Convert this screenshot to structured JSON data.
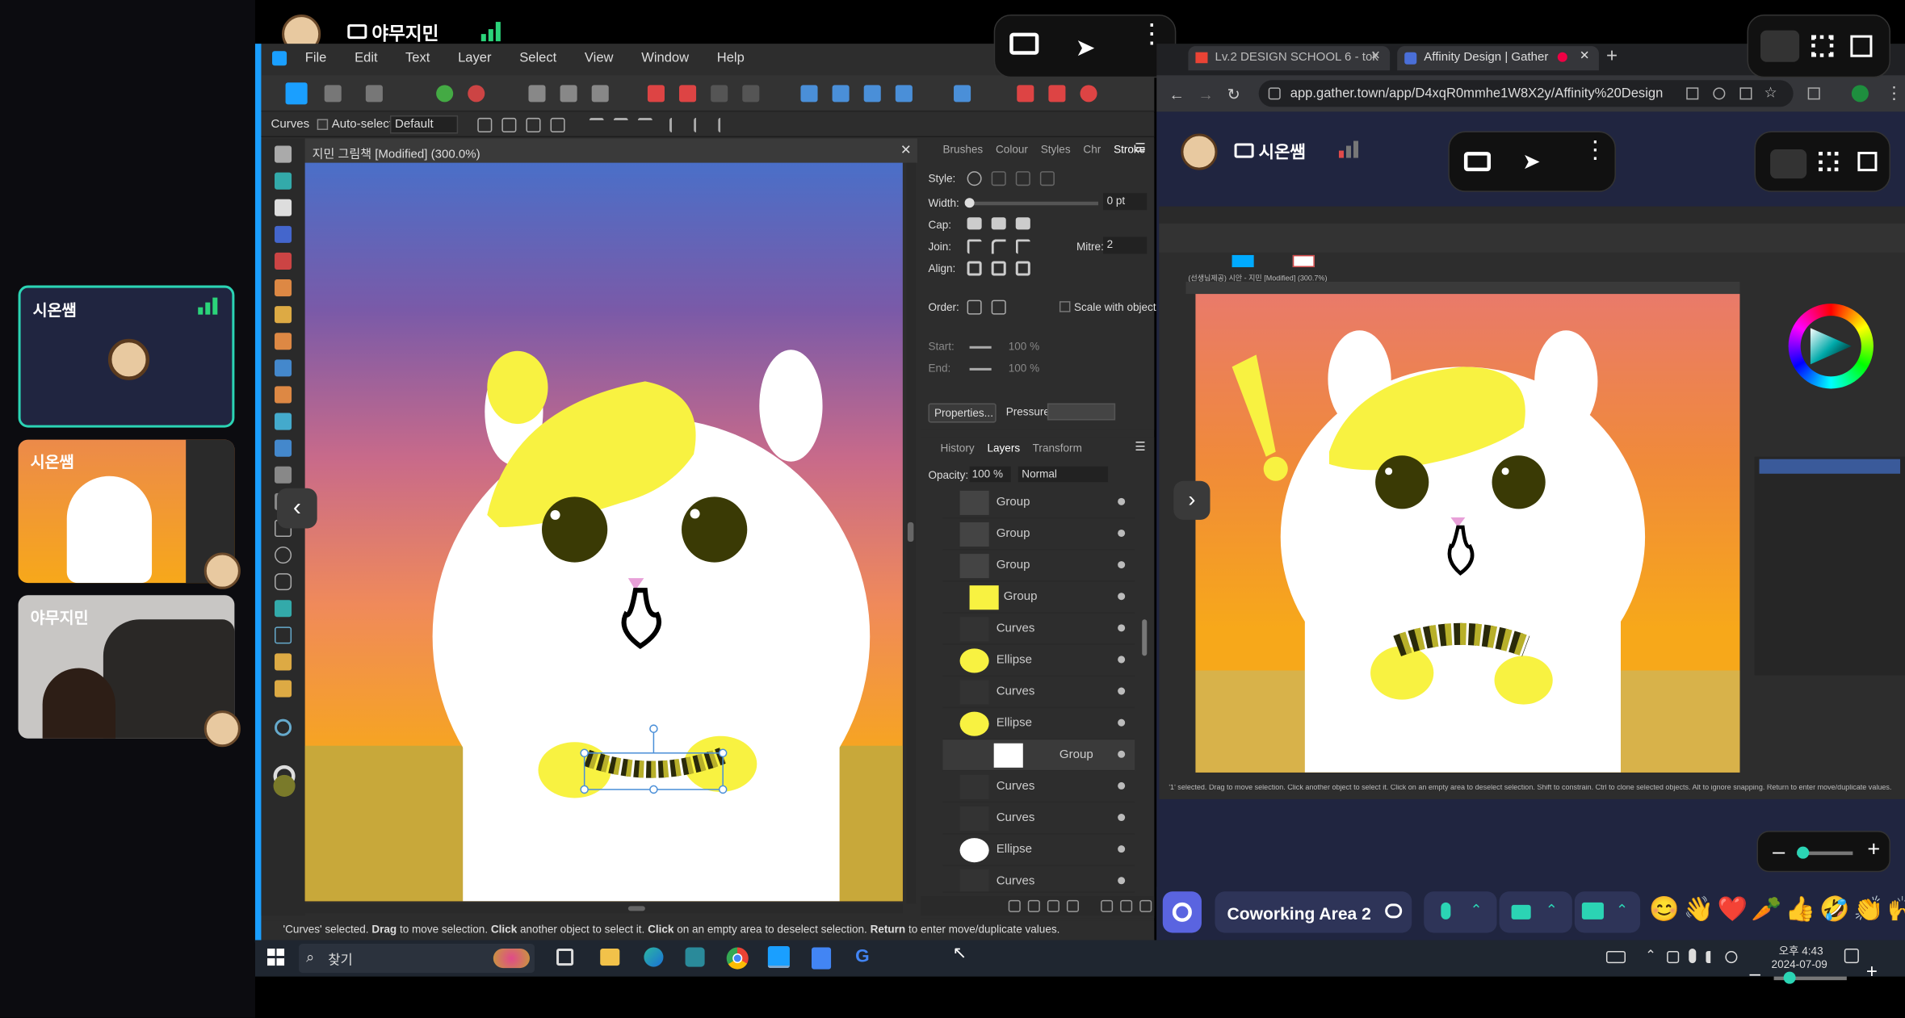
{
  "left_panel": {
    "top_user": "야무지민",
    "tiles": [
      {
        "name": "시온쌤"
      },
      {
        "name": "시온쌤"
      },
      {
        "name": "야무지민"
      }
    ]
  },
  "affinity": {
    "menu": [
      "File",
      "Edit",
      "Text",
      "Layer",
      "Select",
      "View",
      "Window",
      "Help"
    ],
    "context_tool": "Curves",
    "auto_select_label": "Auto-select:",
    "auto_select_value": "Default",
    "doc_title": "지민 그림책 [Modified] (300.0%)",
    "stroke_tabs": [
      "Brushes",
      "Colour",
      "Styles",
      "Chr",
      "Stroke"
    ],
    "stroke": {
      "style_label": "Style:",
      "width_label": "Width:",
      "width_value": "0 pt",
      "cap_label": "Cap:",
      "join_label": "Join:",
      "mitre_label": "Mitre:",
      "mitre_value": "2",
      "align_label": "Align:",
      "order_label": "Order:",
      "scale_label": "Scale with object",
      "start_label": "Start:",
      "end_label": "End:",
      "start_pct": "100 %",
      "start_pct2": "100 %",
      "end_pct": "100 %",
      "end_pct2": "100 %",
      "properties_btn": "Properties...",
      "pressure_label": "Pressure:"
    },
    "layer_tabs": [
      "History",
      "Layers",
      "Transform"
    ],
    "opacity_label": "Opacity:",
    "opacity_value": "100 %",
    "blend_mode": "Normal",
    "layers": [
      "Group",
      "Group",
      "Group",
      "Group",
      "Curves",
      "Ellipse",
      "Curves",
      "Ellipse",
      "Group",
      "Curves",
      "Curves",
      "Ellipse",
      "Curves"
    ],
    "status_parts": [
      "'Curves' selected. ",
      "Drag",
      " to move selection. ",
      "Click",
      " another object to select it. ",
      "Click",
      " on an empty area to deselect selection. ",
      "Return",
      " to enter move/duplicate values."
    ]
  },
  "browser": {
    "tabs": [
      "Lv.2 DESIGN SCHOOL 6 - tok",
      "Affinity Design | Gather"
    ],
    "url": "app.gather.town/app/D4xqR0mmhe1W8X2y/Affinity%20Design",
    "user": "시온쌤",
    "remote_status": "'1' selected. Drag to move selection. Click another object to select it. Click on an empty area to deselect selection. Shift to constrain. Ctrl to clone selected objects. Alt to ignore snapping. Return to enter move/duplicate values.",
    "remote_title": "(선생님제공) 시안 - 지민 [Modified] (300.7%)",
    "space_name": "Coworking Area 2",
    "emojis": [
      "😊",
      "👋",
      "❤️",
      "🥕",
      "👍",
      "🤣",
      "👏",
      "🙌"
    ]
  },
  "taskbar": {
    "search": "찾기",
    "time": "오후 4:43",
    "date": "2024-07-09"
  },
  "colors": {
    "gather_bg": "#202540",
    "accent_teal": "#2bd4b4",
    "affinity_blue": "#1a9fff",
    "hamster_yellow": "#f8f241",
    "bg_top": "#4a6fc8",
    "bg_bottom": "#f7a81a"
  }
}
